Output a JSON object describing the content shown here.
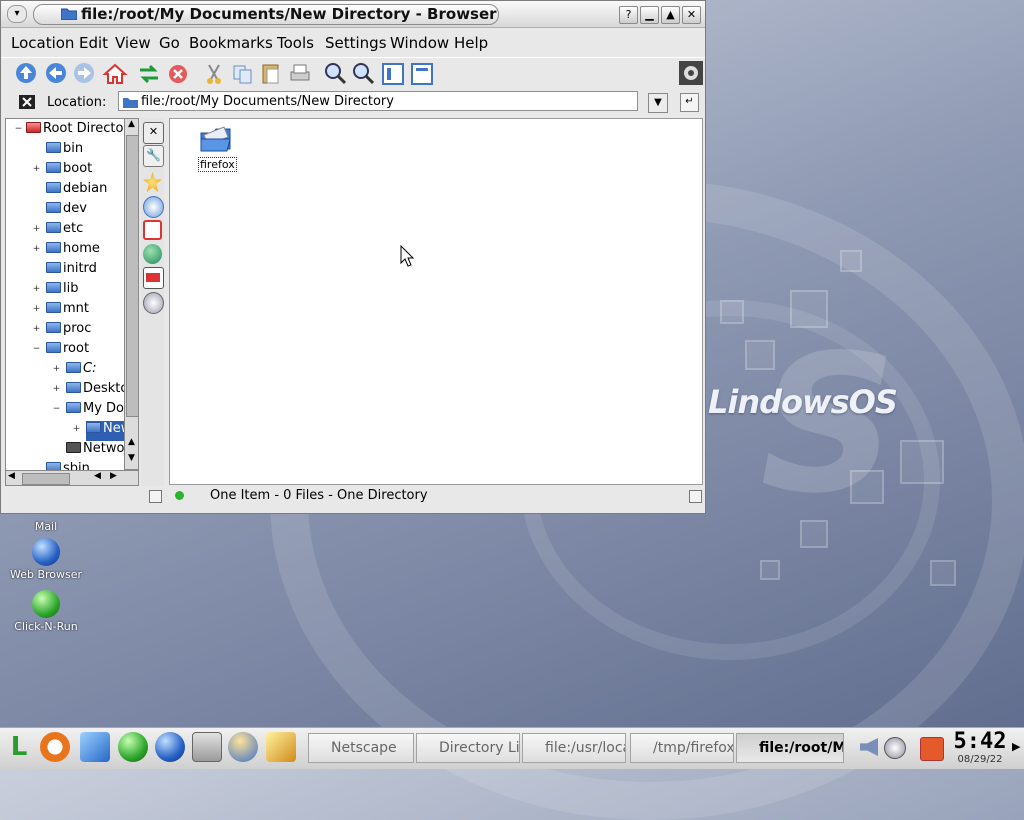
{
  "window": {
    "title": "file:/root/My Documents/New Directory - Browser",
    "menu": [
      "Location",
      "Edit",
      "View",
      "Go",
      "Bookmarks",
      "Tools",
      "Settings",
      "Window",
      "Help"
    ],
    "location_label": "Location:",
    "location_value": "file:/root/My Documents/New Directory"
  },
  "tree": {
    "items": [
      {
        "label": "Root Director"
      },
      {
        "label": "bin"
      },
      {
        "label": "boot"
      },
      {
        "label": "debian"
      },
      {
        "label": "dev"
      },
      {
        "label": "etc"
      },
      {
        "label": "home"
      },
      {
        "label": "initrd"
      },
      {
        "label": "lib"
      },
      {
        "label": "mnt"
      },
      {
        "label": "proc"
      },
      {
        "label": "root"
      },
      {
        "label": "C:"
      },
      {
        "label": "Deskto"
      },
      {
        "label": "My Do"
      },
      {
        "label": "New"
      },
      {
        "label": "Netwo"
      },
      {
        "label": "sbin"
      }
    ]
  },
  "main": {
    "file_label": "firefox"
  },
  "status": {
    "text": "One Item - 0 Files - One Directory"
  },
  "desktop": {
    "icons": [
      "Mail",
      "Web Browser",
      "Click-N-Run"
    ]
  },
  "taskbar": {
    "tasks": [
      "Netscape",
      "Directory Lis",
      "file:/usr/loca",
      "/tmp/firefox",
      "file:/root/My"
    ],
    "clock_time": "5:42",
    "clock_date": "08/29/22"
  },
  "colors": {
    "selection": "#2f5fb0",
    "folder": "#3f74c6",
    "status_led": "#2bb52b"
  }
}
